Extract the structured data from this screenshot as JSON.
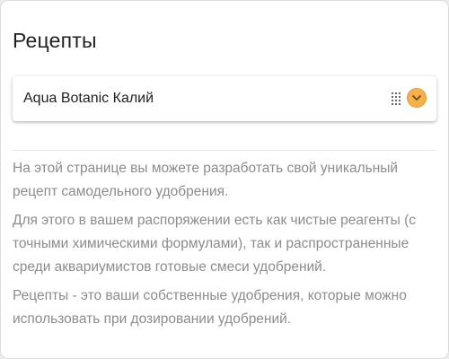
{
  "page": {
    "title": "Рецепты"
  },
  "selector": {
    "value": "Aqua Botanic Калий",
    "drag_icon": "drag-handle-icon",
    "toggle_icon": "chevron-down-icon",
    "accent_color": "#f6b04b"
  },
  "description": {
    "paragraphs": [
      "На этой странице вы можете разработать свой уникальный рецепт самодельного удобрения.",
      "Для этого в вашем распоряжении есть как чистые реагенты (с точными химическими формулами), так и распространенные среди аквариумистов готовые смеси удобрений.",
      "Рецепты - это ваши собственные удобрения, которые можно использовать при дозировании удобрений."
    ]
  }
}
